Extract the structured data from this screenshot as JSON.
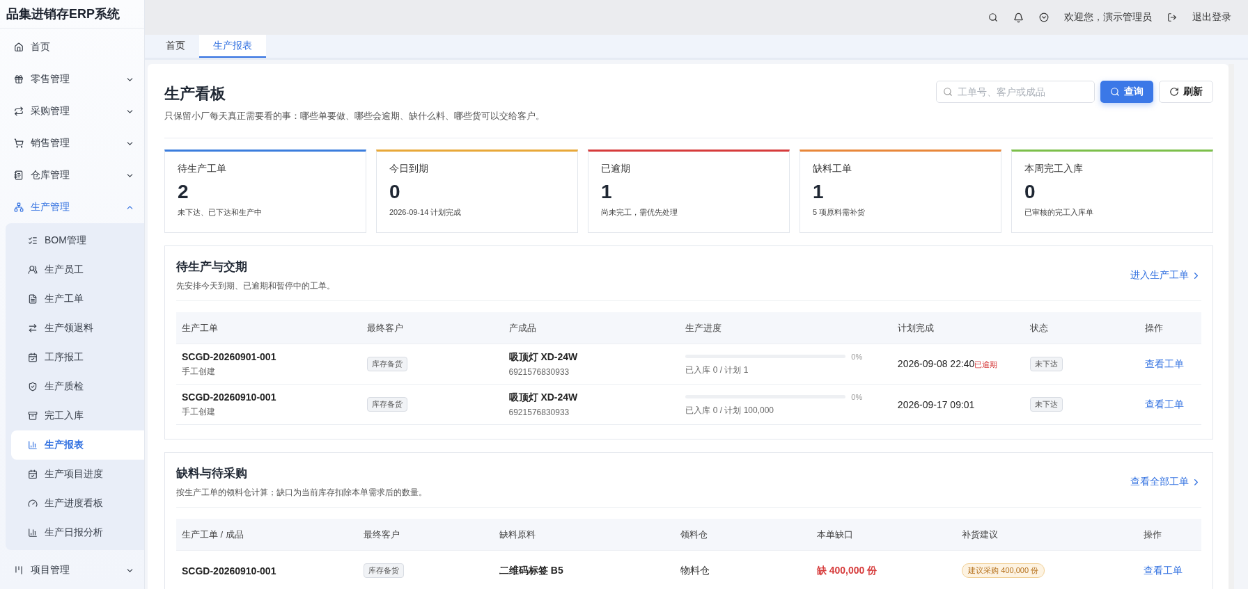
{
  "app_title": "品集进销存ERP系统",
  "sidebar": {
    "items": [
      {
        "label": "首页",
        "kind": "link",
        "selected": false
      },
      {
        "label": "零售管理",
        "kind": "group",
        "expanded": false,
        "selected": false
      },
      {
        "label": "采购管理",
        "kind": "group",
        "expanded": false,
        "selected": false
      },
      {
        "label": "销售管理",
        "kind": "group",
        "expanded": false,
        "selected": false
      },
      {
        "label": "仓库管理",
        "kind": "group",
        "expanded": false,
        "selected": false
      },
      {
        "label": "生产管理",
        "kind": "group",
        "expanded": true,
        "selected": true,
        "children": [
          {
            "label": "BOM管理",
            "selected": false
          },
          {
            "label": "生产员工",
            "selected": false
          },
          {
            "label": "生产工单",
            "selected": false
          },
          {
            "label": "生产领退料",
            "selected": false
          },
          {
            "label": "工序报工",
            "selected": false
          },
          {
            "label": "生产质检",
            "selected": false
          },
          {
            "label": "完工入库",
            "selected": false
          },
          {
            "label": "生产报表",
            "selected": true
          },
          {
            "label": "生产项目进度",
            "selected": false
          },
          {
            "label": "生产进度看板",
            "selected": false
          },
          {
            "label": "生产日报分析",
            "selected": false
          }
        ]
      },
      {
        "label": "项目管理",
        "kind": "group",
        "expanded": false,
        "selected": false
      }
    ]
  },
  "header": {
    "greeting": "欢迎您，演示管理员",
    "logout": "退出登录"
  },
  "tabs": [
    {
      "label": "首页",
      "selected": false
    },
    {
      "label": "生产报表",
      "selected": true
    }
  ],
  "page": {
    "title": "生产看板",
    "subtitle": "只保留小厂每天真正需要看的事：哪些单要做、哪些会逾期、缺什么料、哪些货可以交给客户。",
    "search": {
      "placeholder": "工单号、客户或成品"
    },
    "query_button": "查询",
    "refresh_button": "刷新"
  },
  "kpis": [
    {
      "title": "待生产工单",
      "value": "2",
      "note": "未下达、已下达和生产中",
      "color": "#3b7ddd"
    },
    {
      "title": "今日到期",
      "value": "0",
      "note": "2026-09-14 计划完成",
      "color": "#e8a838"
    },
    {
      "title": "已逾期",
      "value": "1",
      "note": "尚未完工，需优先处理",
      "color": "#d63b3b"
    },
    {
      "title": "缺料工单",
      "value": "1",
      "note": "5 项原料需补货",
      "color": "#e8873a"
    },
    {
      "title": "本周完工入库",
      "value": "0",
      "note": "已审核的完工入库单",
      "color": "#7cbf4a"
    }
  ],
  "pending": {
    "title": "待生产与交期",
    "subtitle": "先安排今天到期、已逾期和暂停中的工单。",
    "link": "进入生产工单",
    "columns": [
      "生产工单",
      "最终客户",
      "产成品",
      "生产进度",
      "计划完成",
      "状态",
      "操作"
    ],
    "rows": [
      {
        "order": "SCGD-20260901-001",
        "source": "手工创建",
        "customer": "库存备货",
        "product": "吸顶灯 XD-24W",
        "code": "6921576830933",
        "level": 0,
        "percent": "0%",
        "progress_note": "已入库 0 / 计划 1",
        "planned": "2026-09-08 22:40",
        "overdue": "已逾期",
        "status": "未下达",
        "action": "查看工单"
      },
      {
        "order": "SCGD-20260910-001",
        "source": "手工创建",
        "customer": "库存备货",
        "product": "吸顶灯 XD-24W",
        "code": "6921576830933",
        "level": 0,
        "percent": "0%",
        "progress_note": "已入库 0 / 计划 100,000",
        "planned": "2026-09-17 09:01",
        "status": "未下达",
        "action": "查看工单"
      }
    ]
  },
  "shortage": {
    "title": "缺料与待采购",
    "subtitle": "按生产工单的领料仓计算；缺口为当前库存扣除本单需求后的数量。",
    "link": "查看全部工单",
    "columns": [
      "生产工单 / 成品",
      "最终客户",
      "缺料原料",
      "领料仓",
      "本单缺口",
      "补货建议",
      "操作"
    ],
    "rows": [
      {
        "order": "SCGD-20260910-001",
        "customer": "库存备货",
        "material": "二维码标签 B5",
        "warehouse": "物料仓",
        "gap": "缺 400,000 份",
        "suggestion": "建议采购 400,000 份",
        "action": "查看工单"
      }
    ]
  }
}
